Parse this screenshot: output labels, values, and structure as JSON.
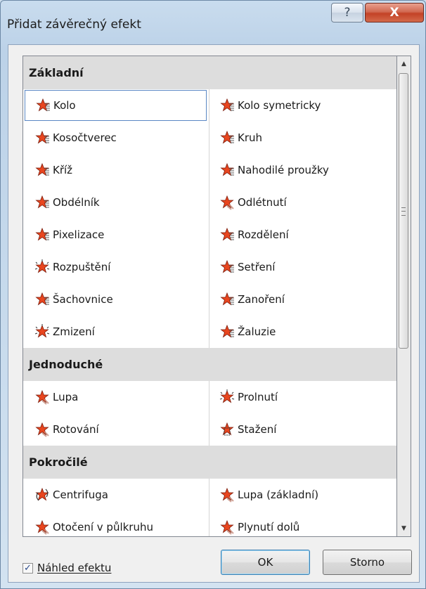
{
  "window": {
    "title": "Přidat závěrečný efekt",
    "help_label": "?",
    "close_label": "X"
  },
  "groups": [
    {
      "header": "Základní",
      "items": [
        {
          "label": "Kolo",
          "icon": "star-stripes-icon"
        },
        {
          "label": "Kolo symetricky",
          "icon": "star-stripes-icon"
        },
        {
          "label": "Kosočtverec",
          "icon": "star-stripes-icon"
        },
        {
          "label": "Kruh",
          "icon": "star-stripes-icon"
        },
        {
          "label": "Kříž",
          "icon": "star-stripes-icon"
        },
        {
          "label": "Nahodilé proužky",
          "icon": "star-stripes-icon"
        },
        {
          "label": "Obdélník",
          "icon": "star-stripes-icon"
        },
        {
          "label": "Odlétnutí",
          "icon": "star-fly-icon"
        },
        {
          "label": "Pixelizace",
          "icon": "star-stripes-icon"
        },
        {
          "label": "Rozdělení",
          "icon": "star-stripes-icon"
        },
        {
          "label": "Rozpuštění",
          "icon": "star-burst-icon"
        },
        {
          "label": "Setření",
          "icon": "star-stripes-icon"
        },
        {
          "label": "Šachovnice",
          "icon": "star-stripes-icon"
        },
        {
          "label": "Zanoření",
          "icon": "star-stripes-icon"
        },
        {
          "label": "Zmizení",
          "icon": "star-burst-icon"
        },
        {
          "label": "Žaluzie",
          "icon": "star-stripes-icon"
        }
      ]
    },
    {
      "header": "Jednoduché",
      "items": [
        {
          "label": "Lupa",
          "icon": "star-fly-icon"
        },
        {
          "label": "Prolnutí",
          "icon": "star-burst-icon"
        },
        {
          "label": "Rotování",
          "icon": "star-fly-icon"
        },
        {
          "label": "Stažení",
          "icon": "star-shrink-icon"
        }
      ]
    },
    {
      "header": "Pokročilé",
      "items": [
        {
          "label": "Centrifuga",
          "icon": "star-spin-icon"
        },
        {
          "label": "Lupa (základní)",
          "icon": "star-fly-icon"
        },
        {
          "label": "Otočení v půlkruhu",
          "icon": "star-fly-icon"
        },
        {
          "label": "Plynutí dolů",
          "icon": "star-fly-icon"
        }
      ]
    }
  ],
  "selected_item": "Kolo",
  "preview_checkbox": {
    "label": "Náhled efektu",
    "checked": true
  },
  "buttons": {
    "ok": "OK",
    "cancel": "Storno"
  },
  "colors": {
    "star": "#e8461f",
    "star_outline": "#7a1a0a",
    "accent": "#5a87c4"
  }
}
